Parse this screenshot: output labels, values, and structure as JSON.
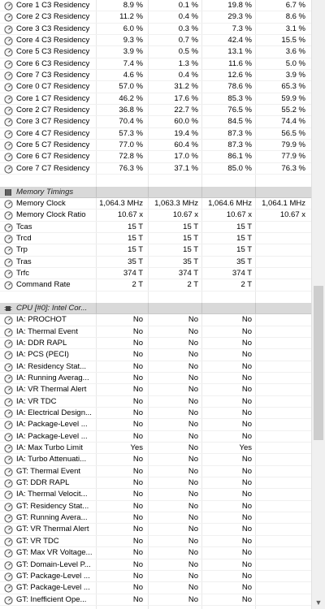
{
  "rows_top": [
    {
      "label": "Core 1 C3 Residency",
      "v": [
        "8.9 %",
        "0.1 %",
        "19.8 %",
        "6.7 %"
      ]
    },
    {
      "label": "Core 2 C3 Residency",
      "v": [
        "11.2 %",
        "0.4 %",
        "29.3 %",
        "8.6 %"
      ]
    },
    {
      "label": "Core 3 C3 Residency",
      "v": [
        "6.0 %",
        "0.3 %",
        "7.3 %",
        "3.1 %"
      ]
    },
    {
      "label": "Core 4 C3 Residency",
      "v": [
        "9.3 %",
        "0.7 %",
        "42.4 %",
        "15.5 %"
      ]
    },
    {
      "label": "Core 5 C3 Residency",
      "v": [
        "3.9 %",
        "0.5 %",
        "13.1 %",
        "3.6 %"
      ]
    },
    {
      "label": "Core 6 C3 Residency",
      "v": [
        "7.4 %",
        "1.3 %",
        "11.6 %",
        "5.0 %"
      ]
    },
    {
      "label": "Core 7 C3 Residency",
      "v": [
        "4.6 %",
        "0.4 %",
        "12.6 %",
        "3.9 %"
      ]
    },
    {
      "label": "Core 0 C7 Residency",
      "v": [
        "57.0 %",
        "31.2 %",
        "78.6 %",
        "65.3 %"
      ]
    },
    {
      "label": "Core 1 C7 Residency",
      "v": [
        "46.2 %",
        "17.6 %",
        "85.3 %",
        "59.9 %"
      ]
    },
    {
      "label": "Core 2 C7 Residency",
      "v": [
        "36.8 %",
        "22.7 %",
        "76.5 %",
        "55.2 %"
      ]
    },
    {
      "label": "Core 3 C7 Residency",
      "v": [
        "70.4 %",
        "60.0 %",
        "84.5 %",
        "74.4 %"
      ]
    },
    {
      "label": "Core 4 C7 Residency",
      "v": [
        "57.3 %",
        "19.4 %",
        "87.3 %",
        "56.5 %"
      ]
    },
    {
      "label": "Core 5 C7 Residency",
      "v": [
        "77.0 %",
        "60.4 %",
        "87.3 %",
        "79.9 %"
      ]
    },
    {
      "label": "Core 6 C7 Residency",
      "v": [
        "72.8 %",
        "17.0 %",
        "86.1 %",
        "77.9 %"
      ]
    },
    {
      "label": "Core 7 C7 Residency",
      "v": [
        "76.3 %",
        "37.1 %",
        "85.0 %",
        "76.3 %"
      ]
    }
  ],
  "memory_section": {
    "title": "Memory Timings",
    "rows": [
      {
        "label": "Memory Clock",
        "v": [
          "1,064.3 MHz",
          "1,063.3 MHz",
          "1,064.6 MHz",
          "1,064.1 MHz"
        ]
      },
      {
        "label": "Memory Clock Ratio",
        "v": [
          "10.67 x",
          "10.67 x",
          "10.67 x",
          "10.67 x"
        ]
      },
      {
        "label": "Tcas",
        "v": [
          "15 T",
          "15 T",
          "15 T",
          ""
        ]
      },
      {
        "label": "Trcd",
        "v": [
          "15 T",
          "15 T",
          "15 T",
          ""
        ]
      },
      {
        "label": "Trp",
        "v": [
          "15 T",
          "15 T",
          "15 T",
          ""
        ]
      },
      {
        "label": "Tras",
        "v": [
          "35 T",
          "35 T",
          "35 T",
          ""
        ]
      },
      {
        "label": "Trfc",
        "v": [
          "374 T",
          "374 T",
          "374 T",
          ""
        ]
      },
      {
        "label": "Command Rate",
        "v": [
          "2 T",
          "2 T",
          "2 T",
          ""
        ]
      }
    ]
  },
  "cpu_section": {
    "title": "CPU [#0]: Intel Cor...",
    "rows": [
      {
        "label": "IA: PROCHOT",
        "v": [
          "No",
          "No",
          "No",
          ""
        ]
      },
      {
        "label": "IA: Thermal Event",
        "v": [
          "No",
          "No",
          "No",
          ""
        ]
      },
      {
        "label": "IA: DDR RAPL",
        "v": [
          "No",
          "No",
          "No",
          ""
        ]
      },
      {
        "label": "IA: PCS (PECI)",
        "v": [
          "No",
          "No",
          "No",
          ""
        ]
      },
      {
        "label": "IA: Residency Stat...",
        "v": [
          "No",
          "No",
          "No",
          ""
        ]
      },
      {
        "label": "IA: Running Averag...",
        "v": [
          "No",
          "No",
          "No",
          ""
        ]
      },
      {
        "label": "IA: VR Thermal Alert",
        "v": [
          "No",
          "No",
          "No",
          ""
        ]
      },
      {
        "label": "IA: VR TDC",
        "v": [
          "No",
          "No",
          "No",
          ""
        ]
      },
      {
        "label": "IA: Electrical Design...",
        "v": [
          "No",
          "No",
          "No",
          ""
        ]
      },
      {
        "label": "IA: Package-Level ...",
        "v": [
          "No",
          "No",
          "No",
          ""
        ]
      },
      {
        "label": "IA: Package-Level ...",
        "v": [
          "No",
          "No",
          "No",
          ""
        ]
      },
      {
        "label": "IA: Max Turbo Limit",
        "v": [
          "Yes",
          "No",
          "Yes",
          ""
        ]
      },
      {
        "label": "IA: Turbo Attenuati...",
        "v": [
          "No",
          "No",
          "No",
          ""
        ]
      },
      {
        "label": "GT: Thermal Event",
        "v": [
          "No",
          "No",
          "No",
          ""
        ]
      },
      {
        "label": "GT: DDR RAPL",
        "v": [
          "No",
          "No",
          "No",
          ""
        ]
      },
      {
        "label": "IA: Thermal Velocit...",
        "v": [
          "No",
          "No",
          "No",
          ""
        ]
      },
      {
        "label": "GT: Residency Stat...",
        "v": [
          "No",
          "No",
          "No",
          ""
        ]
      },
      {
        "label": "GT: Running Avera...",
        "v": [
          "No",
          "No",
          "No",
          ""
        ]
      },
      {
        "label": "GT: VR Thermal Alert",
        "v": [
          "No",
          "No",
          "No",
          ""
        ]
      },
      {
        "label": "GT: VR TDC",
        "v": [
          "No",
          "No",
          "No",
          ""
        ]
      },
      {
        "label": "GT: Max VR Voltage...",
        "v": [
          "No",
          "No",
          "No",
          ""
        ]
      },
      {
        "label": "GT: Domain-Level P...",
        "v": [
          "No",
          "No",
          "No",
          ""
        ]
      },
      {
        "label": "GT: Package-Level ...",
        "v": [
          "No",
          "No",
          "No",
          ""
        ]
      },
      {
        "label": "GT: Package-Level ...",
        "v": [
          "No",
          "No",
          "No",
          ""
        ]
      },
      {
        "label": "GT: Inefficient Ope...",
        "v": [
          "No",
          "No",
          "No",
          ""
        ]
      }
    ]
  },
  "icons": {
    "sensor_row": "gauge-icon",
    "memory_header": "memory-chip-icon",
    "cpu_header": "cpu-chip-icon"
  },
  "colors": {
    "section_bg": "#d9d9d9",
    "grid": "#e8e8e8",
    "scrollbar": "#f0f0f0",
    "thumb": "#cdcdcd"
  }
}
